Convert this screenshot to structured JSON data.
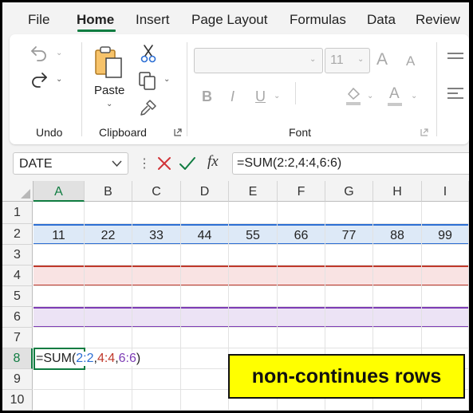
{
  "menu": {
    "tabs": [
      {
        "label": "File",
        "active": false
      },
      {
        "label": "Home",
        "active": true
      },
      {
        "label": "Insert",
        "active": false
      },
      {
        "label": "Page Layout",
        "active": false
      },
      {
        "label": "Formulas",
        "active": false
      },
      {
        "label": "Data",
        "active": false
      },
      {
        "label": "Review",
        "active": false
      }
    ]
  },
  "ribbon": {
    "undo_group": {
      "label": "Undo"
    },
    "clipboard_group": {
      "label": "Clipboard",
      "paste_label": "Paste"
    },
    "font_group": {
      "label": "Font",
      "font_size": "11",
      "bold": "B",
      "italic": "I",
      "underline": "U",
      "grow": "A",
      "shrink": "A"
    }
  },
  "formula_bar": {
    "name_box": "DATE",
    "fx": "fx",
    "formula": "=SUM(2:2,4:4,6:6)"
  },
  "grid": {
    "columns": [
      "A",
      "B",
      "C",
      "D",
      "E",
      "F",
      "G",
      "H",
      "I"
    ],
    "rows": [
      "1",
      "2",
      "3",
      "4",
      "5",
      "6",
      "7",
      "8",
      "9",
      "10"
    ],
    "row2_values": [
      "11",
      "22",
      "33",
      "44",
      "55",
      "66",
      "77",
      "88",
      "99"
    ],
    "editing_cell": {
      "address": "A8",
      "parts": [
        {
          "text": "=SUM(",
          "color": "#222222"
        },
        {
          "text": "2:2",
          "color": "#2d6fd4"
        },
        {
          "text": ",",
          "color": "#222222"
        },
        {
          "text": "4:4",
          "color": "#c0392b"
        },
        {
          "text": ",",
          "color": "#222222"
        },
        {
          "text": "6:6",
          "color": "#7d3cb5"
        },
        {
          "text": ")",
          "color": "#222222"
        }
      ]
    },
    "highlight_colors": {
      "row2": "#2d6fd4",
      "row4": "#c0392b",
      "row6": "#7d3cb5"
    }
  },
  "callout": {
    "text": "non-continues rows"
  },
  "colors": {
    "accent": "#107c41"
  }
}
